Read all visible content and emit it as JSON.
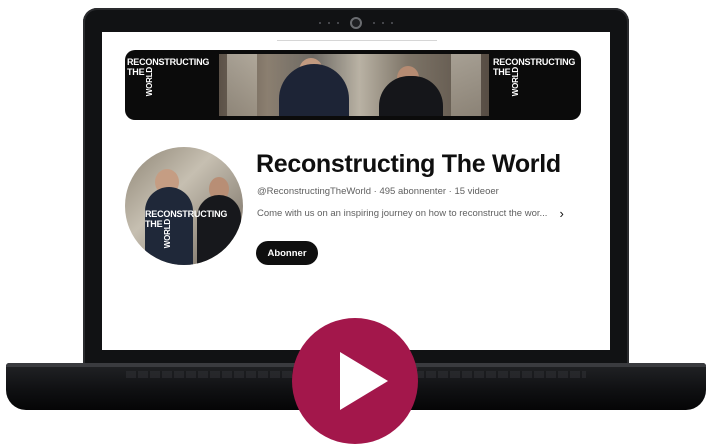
{
  "banner": {
    "brand_left_line1": "RECONSTRUCTING",
    "brand_left_the": "THE",
    "brand_left_world": "WORLD",
    "brand_right_line1": "RECONSTRUCTING",
    "brand_right_the": "THE",
    "brand_right_world": "WORLD"
  },
  "avatar": {
    "brand_line1": "RECONSTRUCTING",
    "brand_the": "THE",
    "brand_world": "WORLD"
  },
  "channel": {
    "title": "Reconstructing The World",
    "meta": "@ReconstructingTheWorld · 495 abonnenter · 15 videoer",
    "description": "Come with us on an inspiring journey on how to reconstruct the wor...",
    "description_more_icon": "chevron-right-icon",
    "subscribe_label": "Abonner"
  },
  "overlay": {
    "play_icon": "play-icon",
    "play_color": "#a3174b"
  },
  "colors": {
    "laptop_body": "#111214",
    "subscribe_bg": "#0f0f0f",
    "meta_text": "#606060"
  }
}
